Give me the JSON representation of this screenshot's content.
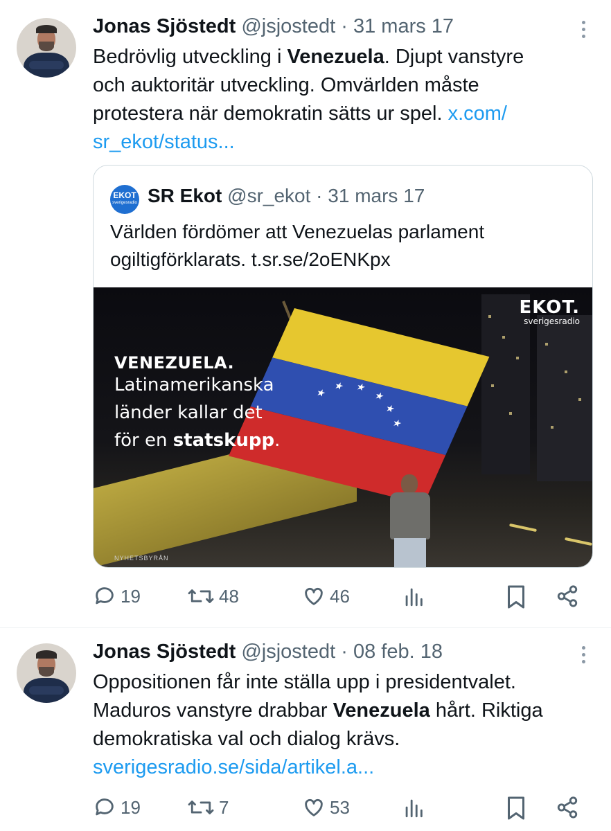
{
  "tweets": [
    {
      "author_name": "Jonas Sjöstedt",
      "handle": "@jsjostedt",
      "separator": "·",
      "date": "31 mars 17",
      "text_line1_a": "Bedrövlig utveckling i ",
      "text_line1_bold": "Venezuela",
      "text_line1_b": ". Djupt vanstyre",
      "text_line2": "och auktoritär utveckling. Omvärlden måste",
      "text_line3": "protestera när demokratin sätts ur spel. ",
      "link_part1": "x.com/",
      "link_part2": "sr_ekot/status...",
      "quote": {
        "avatar_text": "EKOT",
        "avatar_sub": "sverigesradio",
        "author_name": "SR Ekot",
        "handle": "@sr_ekot",
        "separator": "·",
        "date": "31 mars 17",
        "text_line1": "Världen fördömer att Venezuelas parlament",
        "text_line2": "ogiltigförklarats. t.sr.se/2oENKpx",
        "image": {
          "heading": "VENEZUELA.",
          "line1": "Latinamerikanska",
          "line2": "länder kallar det",
          "line3_a": "för en ",
          "line3_bold": "statskupp",
          "line3_b": ".",
          "logo_big": "EKOT.",
          "logo_small": "sverigesradio",
          "credit": "NYHETSBYRÅN"
        }
      },
      "actions": {
        "replies": "19",
        "retweets": "48",
        "likes": "46"
      }
    },
    {
      "author_name": "Jonas Sjöstedt",
      "handle": "@jsjostedt",
      "separator": "·",
      "date": "08 feb. 18",
      "text_line1": "Oppositionen får inte ställa upp i presidentvalet.",
      "text_line2_a": "Maduros vanstyre drabbar ",
      "text_line2_bold": "Venezuela",
      "text_line2_b": " hårt. Riktiga",
      "text_line3": "demokratiska val och dialog krävs.",
      "link": "sverigesradio.se/sida/artikel.a...",
      "actions": {
        "replies": "19",
        "retweets": "7",
        "likes": "53"
      }
    }
  ],
  "icons": {
    "reply": "reply-icon",
    "retweet": "retweet-icon",
    "like": "heart-icon",
    "views": "views-icon",
    "bookmark": "bookmark-icon",
    "share": "share-icon",
    "more": "more-icon"
  },
  "colors": {
    "link": "#1d9bf0",
    "muted": "#536471",
    "text": "#0f1419"
  }
}
